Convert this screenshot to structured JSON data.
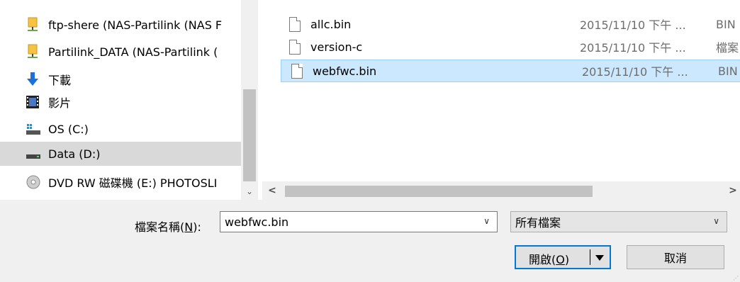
{
  "nav": {
    "items": [
      {
        "label": "ftp-shere (NAS-Partilink (NAS F",
        "icon": "network-drive-icon"
      },
      {
        "label": "Partilink_DATA (NAS-Partilink (",
        "icon": "network-drive-icon"
      },
      {
        "label": "下載",
        "icon": "download-arrow-icon"
      },
      {
        "label": "影片",
        "icon": "video-film-icon"
      },
      {
        "label": "OS (C:)",
        "icon": "os-drive-icon"
      },
      {
        "label": "Data (D:)",
        "icon": "hard-drive-icon",
        "selected": true
      },
      {
        "label": "DVD RW 磁碟機 (E:) PHOTOSLI",
        "icon": "dvd-drive-icon"
      }
    ]
  },
  "files": [
    {
      "name": "allc.bin",
      "date": "2015/11/10 下午 ...",
      "type": "BIN"
    },
    {
      "name": "version-c",
      "date": "2015/11/10 下午 ...",
      "type": "檔案"
    },
    {
      "name": "webfwc.bin",
      "date": "2015/11/10 下午 ...",
      "type": "BIN",
      "selected": true
    }
  ],
  "filename": {
    "label_prefix": "檔案名稱(",
    "label_accel": "N",
    "label_suffix": "):",
    "value": "webfwc.bin"
  },
  "filetype": {
    "value": "所有檔案"
  },
  "buttons": {
    "open_prefix": "開啟(",
    "open_accel": "O",
    "open_suffix": ")",
    "cancel": "取消"
  },
  "colors": {
    "selection_bg": "#cce8ff",
    "selection_border": "#99d1ff",
    "default_button_border": "#0078d7"
  }
}
